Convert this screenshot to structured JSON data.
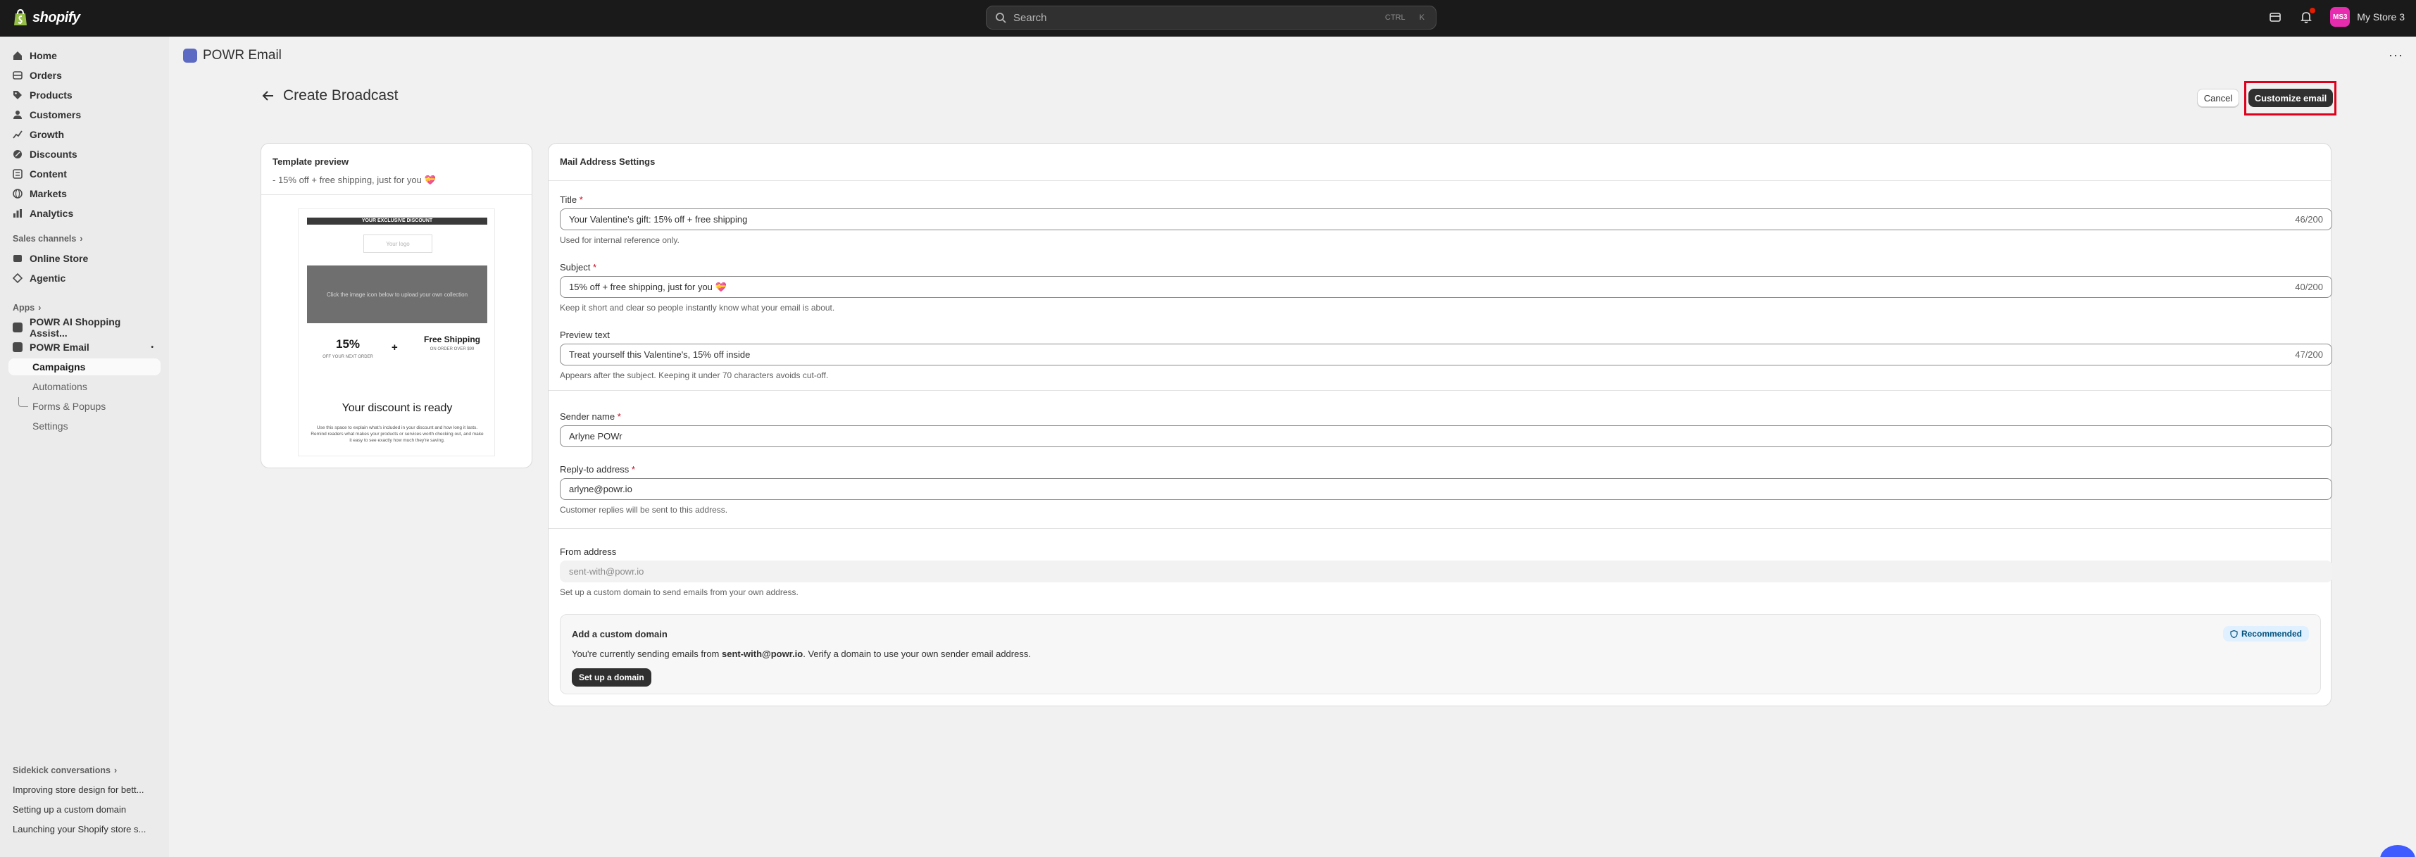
{
  "topbar": {
    "brand": "shopify",
    "search_placeholder": "Search",
    "shortcut_ctrl": "CTRL",
    "shortcut_key": "K",
    "store_initials": "MS3",
    "store_name": "My Store 3"
  },
  "sidebar": {
    "items": [
      {
        "label": "Home"
      },
      {
        "label": "Orders"
      },
      {
        "label": "Products"
      },
      {
        "label": "Customers"
      },
      {
        "label": "Growth"
      },
      {
        "label": "Discounts"
      },
      {
        "label": "Content"
      },
      {
        "label": "Markets"
      },
      {
        "label": "Analytics"
      }
    ],
    "sales_channels_label": "Sales channels",
    "channels": [
      {
        "label": "Online Store"
      },
      {
        "label": "Agentic"
      }
    ],
    "apps_label": "Apps",
    "apps": [
      {
        "label": "POWR AI Shopping Assist..."
      },
      {
        "label": "POWR Email"
      }
    ],
    "sub_items": [
      {
        "label": "Campaigns"
      },
      {
        "label": "Automations"
      },
      {
        "label": "Forms & Popups"
      },
      {
        "label": "Settings"
      }
    ],
    "sidekick_label": "Sidekick conversations",
    "conversations": [
      {
        "label": "Improving store design for bett..."
      },
      {
        "label": "Setting up a custom domain"
      },
      {
        "label": "Launching your Shopify store s..."
      }
    ]
  },
  "main": {
    "app_title": "POWR Email",
    "page_title": "Create Broadcast",
    "cancel_label": "Cancel",
    "customize_label": "Customize email"
  },
  "preview": {
    "heading": "Template preview",
    "subject": "- 15% off + free shipping, just for you 💝",
    "email": {
      "strip": "YOUR EXCLUSIVE DISCOUNT",
      "logo": "Your logo",
      "hero_text": "Click the image icon below to upload your own collection",
      "offer_big": "15%",
      "offer_small": "OFF YOUR NEXT ORDER",
      "plus": "+",
      "ship_big": "Free Shipping",
      "ship_small": "ON ORDER OVER $99",
      "ready": "Your discount is ready",
      "body": "Use this space to explain what's included in your discount and how long it lasts. Remind readers what makes your products or services worth checking out, and make it easy to see exactly how much they're saving."
    }
  },
  "settings": {
    "heading": "Mail Address Settings",
    "title_label": "Title",
    "title_value": "Your Valentine's gift: 15% off + free shipping",
    "title_count": "46/200",
    "title_help": "Used for internal reference only.",
    "subject_label": "Subject",
    "subject_value": "15% off + free shipping, just for you 💝",
    "subject_count": "40/200",
    "subject_help": "Keep it short and clear so people instantly know what your email is about.",
    "preview_label": "Preview text",
    "preview_value": "Treat yourself this Valentine's, 15% off inside",
    "preview_count": "47/200",
    "preview_help": "Appears after the subject. Keeping it under 70 characters avoids cut-off.",
    "sender_label": "Sender name",
    "sender_value": "Arlyne POWr",
    "reply_label": "Reply-to address",
    "reply_value": "arlyne@powr.io",
    "reply_help": "Customer replies will be sent to this address.",
    "from_label": "From address",
    "from_value": "sent-with@powr.io",
    "from_help": "Set up a custom domain to send emails from your own address.",
    "required_mark": "*",
    "domain": {
      "heading": "Add a custom domain",
      "text_pre": "You're currently sending emails from ",
      "text_bold": "sent-with@powr.io",
      "text_post": ". Verify a domain to use your own sender email address.",
      "badge": "Recommended",
      "button": "Set up a domain"
    }
  }
}
